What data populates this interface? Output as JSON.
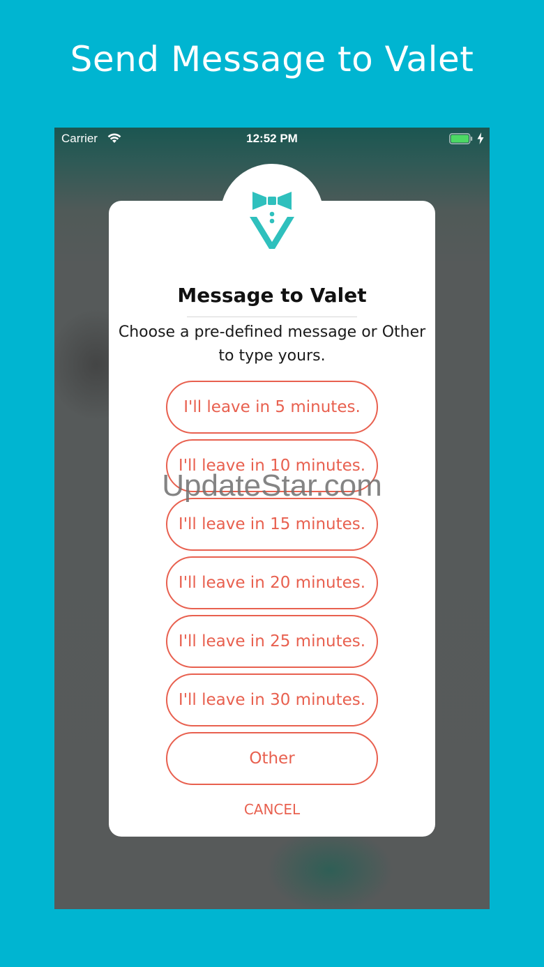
{
  "page": {
    "heading": "Send Message to Valet",
    "watermark": "UpdateStar.com"
  },
  "status_bar": {
    "carrier": "Carrier",
    "time": "12:52 PM",
    "wifi_icon": "wifi-icon",
    "battery_icon": "battery-icon",
    "charging_icon": "charging-bolt-icon"
  },
  "dialog": {
    "logo_icon": "valet-bowtie-logo",
    "title": "Message to Valet",
    "subtitle": "Choose a pre-defined message or Other to type yours.",
    "options": [
      {
        "label": "I'll leave in 5 minutes."
      },
      {
        "label": "I'll leave in 10 minutes."
      },
      {
        "label": "I'll leave in 15 minutes."
      },
      {
        "label": "I'll leave in 20 minutes."
      },
      {
        "label": "I'll leave in 25 minutes."
      },
      {
        "label": "I'll leave in 30 minutes."
      },
      {
        "label": "Other"
      }
    ],
    "cancel_label": "CANCEL"
  },
  "colors": {
    "background": "#00b5d1",
    "accent": "#e8604f",
    "logo_teal": "#2fc0bd",
    "battery_green": "#4cd964"
  }
}
